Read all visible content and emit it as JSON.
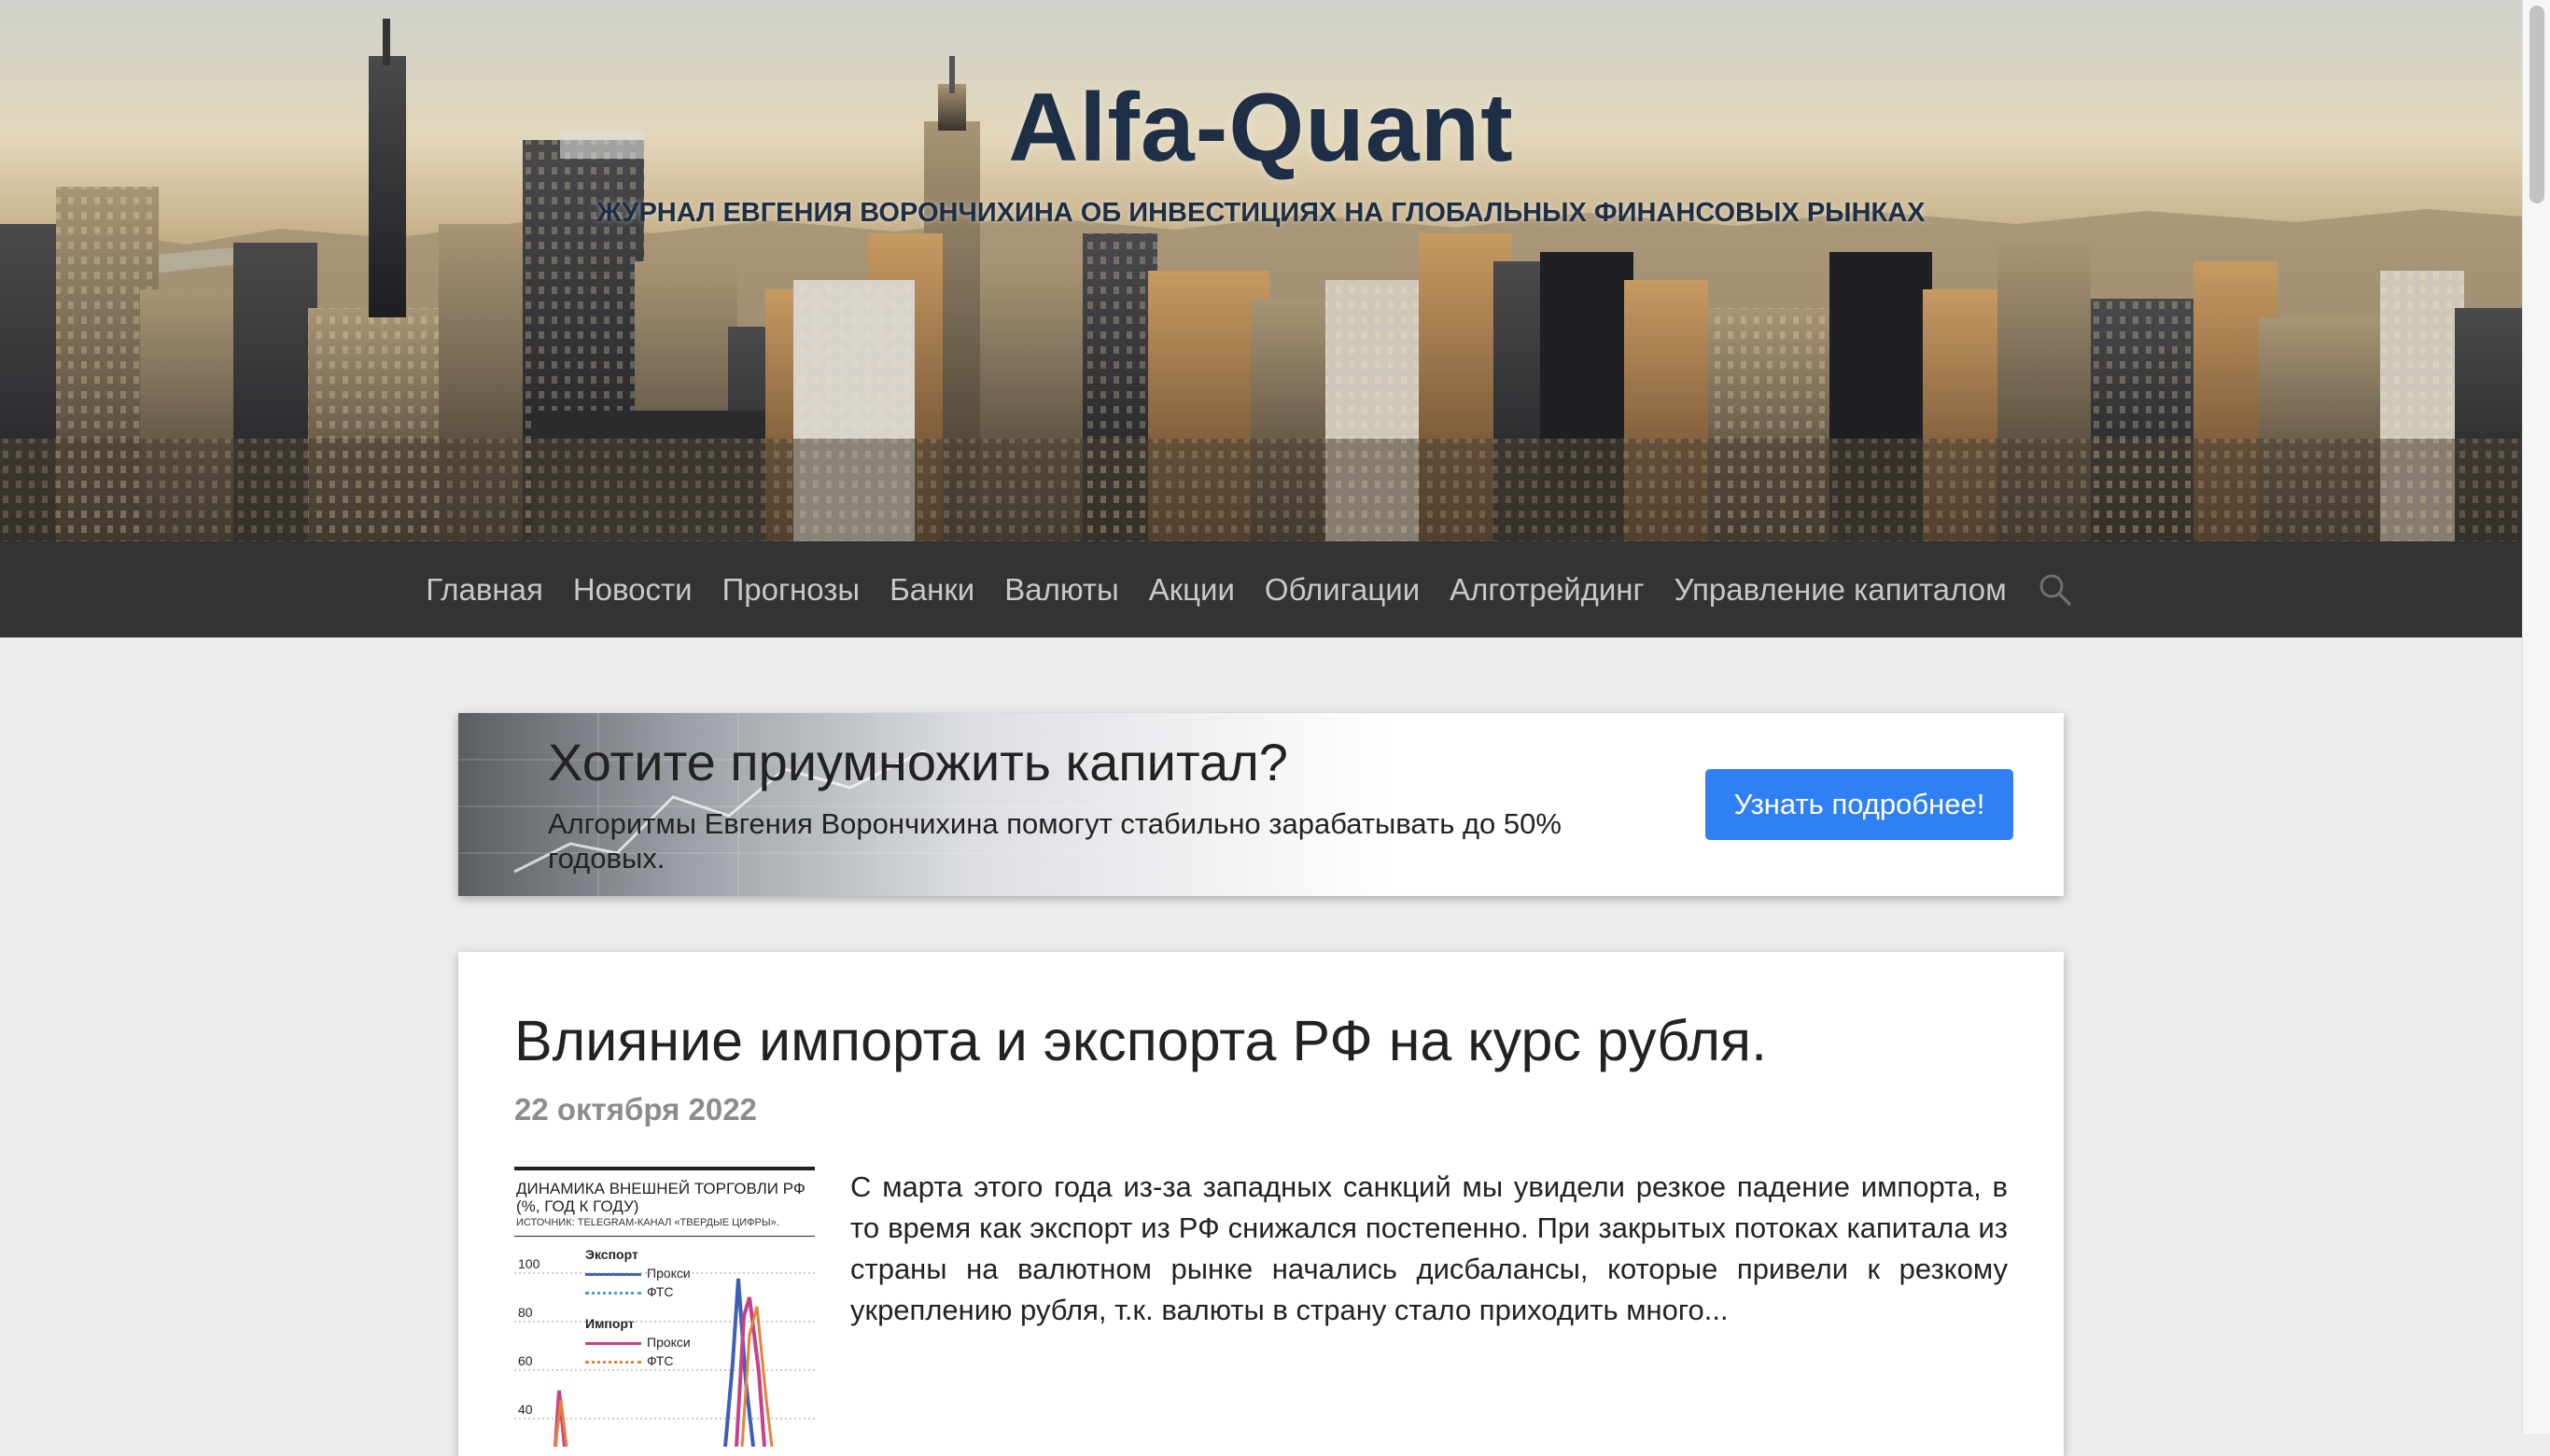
{
  "header": {
    "title": "Alfa-Quant",
    "tagline": "ЖУРНАЛ ЕВГЕНИЯ ВОРОНЧИХИНА ОБ ИНВЕСТИЦИЯХ НА ГЛОБАЛЬНЫХ ФИНАНСОВЫХ РЫНКАХ"
  },
  "nav": {
    "items": [
      {
        "label": "Главная"
      },
      {
        "label": "Новости"
      },
      {
        "label": "Прогнозы"
      },
      {
        "label": "Банки"
      },
      {
        "label": "Валюты"
      },
      {
        "label": "Акции"
      },
      {
        "label": "Облигации"
      },
      {
        "label": "Алготрейдинг"
      },
      {
        "label": "Управление капиталом"
      }
    ],
    "search_icon": "search-icon"
  },
  "promo": {
    "title": "Хотите приумножить капитал?",
    "text": "Алгоритмы Евгения Ворончихина помогут стабильно зарабатывать до 50% годовых.",
    "button_label": "Узнать подробнее!",
    "button_color": "#2f80f5"
  },
  "article": {
    "title": "Влияние импорта и экспорта РФ на курс рубля.",
    "date": "22 октября 2022",
    "excerpt": "С марта этого года из-за западных санкций мы увидели резкое падение импорта, в то время как экспорт из РФ снижался постепенно. При закрытых потоках капитала из страны на валютном рынке начались дисбалансы, которые привели к резкому укреплению рубля, т.к. валюты в страну стало приходить много...",
    "thumbnail": {
      "title": "ДИНАМИКА ВНЕШНЕЙ ТОРГОВЛИ РФ (%, ГОД К ГОДУ)",
      "source": "ИСТОЧНИК: TELEGRAM-КАНАЛ «ТВЕРДЫЕ ЦИФРЫ».",
      "legend": {
        "export_label": "Экспорт",
        "export_proxy": "Прокси",
        "export_fts": "ФТС",
        "import_label": "Импорт",
        "import_proxy": "Прокси",
        "import_fts": "ФТС"
      },
      "y_ticks": [
        "100",
        "80",
        "60",
        "40"
      ]
    }
  },
  "colors": {
    "navbar": "#333333",
    "title": "#1e2f45",
    "date": "#8c8c8c",
    "page_bg": "#ececec"
  }
}
